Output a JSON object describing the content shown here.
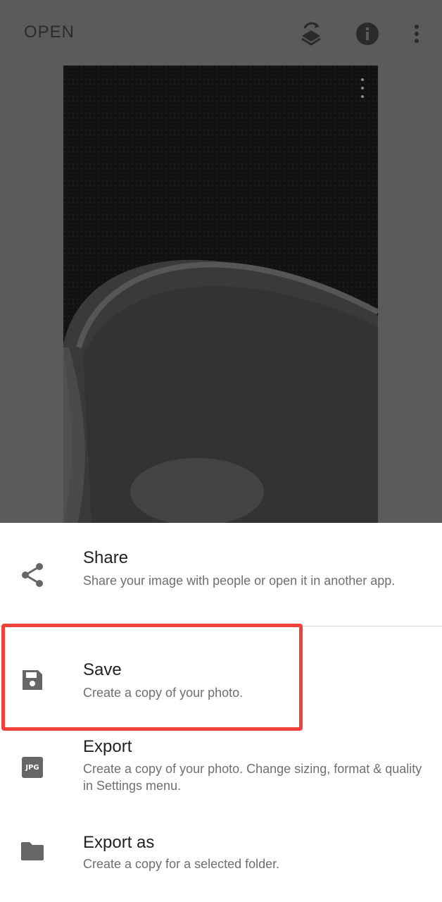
{
  "topbar": {
    "open_label": "OPEN",
    "icons": [
      "layers-icon",
      "info-icon",
      "more-vert-icon"
    ]
  },
  "photo": {
    "menu_icon": "more-vert-icon"
  },
  "sheet": {
    "items": [
      {
        "icon": "share-icon",
        "title": "Share",
        "description": "Share your image with people or open it in another app."
      },
      {
        "icon": "save-icon",
        "title": "Save",
        "description": "Create a copy of your photo."
      },
      {
        "icon": "jpg-icon",
        "icon_text": "JPG",
        "title": "Export",
        "description": "Create a copy of your photo. Change sizing, format & quality in Settings menu."
      },
      {
        "icon": "folder-icon",
        "title": "Export as",
        "description": "Create a copy for a selected folder."
      }
    ]
  },
  "colors": {
    "highlight": "#f2403a",
    "scrim": "#5b5b5b",
    "sheet_bg": "#ffffff"
  }
}
